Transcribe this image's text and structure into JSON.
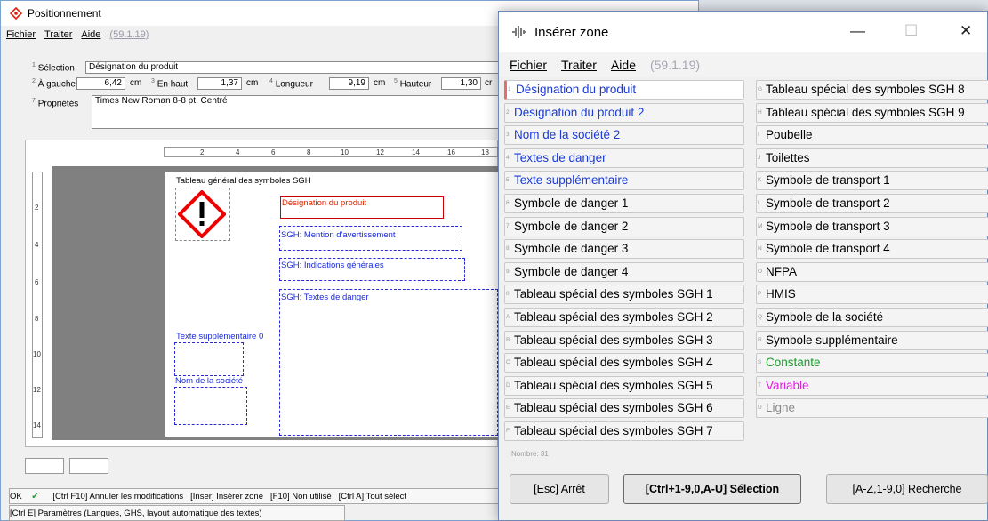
{
  "main": {
    "title": "Positionnement",
    "menu": {
      "fichier": "Fichier",
      "traiter": "Traiter",
      "aide": "Aide",
      "version": "(59.1.19)"
    },
    "fields": {
      "selection_label": "Sélection",
      "selection_value": "Désignation du produit",
      "left_label": "À gauche",
      "left_value": "6,42",
      "left_unit": "cm",
      "top_label": "En haut",
      "top_value": "1,37",
      "top_unit": "cm",
      "length_label": "Longueur",
      "length_value": "9,19",
      "length_unit": "cm",
      "height_label": "Hauteur",
      "height_value": "1,30",
      "height_unit": "cr",
      "props_label": "Propriétés",
      "props_value": "Times New Roman 8-8 pt, Centré"
    },
    "ruler_h": [
      "2",
      "4",
      "6",
      "8",
      "10",
      "12",
      "14",
      "16",
      "18"
    ],
    "ruler_v": [
      "2",
      "4",
      "6",
      "8",
      "10",
      "12",
      "14"
    ],
    "label": {
      "title": "Tableau général des symboles SGH",
      "product": "Désignation du produit",
      "warning": "SGH: Mention d'avertissement",
      "general": "SGH: Indications générales",
      "danger": "SGH: Textes de danger",
      "extra": "Texte supplémentaire 0",
      "company": "Nom de la société"
    },
    "bottom1": {
      "ok": "OK",
      "annuler": "[Ctrl F10] Annuler les modifications",
      "inserer": "[Inser] Insérer zone",
      "non": "[F10] Non utilisé",
      "tout": "[Ctrl A] Tout sélect"
    },
    "bottom2": "[Ctrl E] Paramètres (Langues, GHS, layout automatique des textes)"
  },
  "dialog": {
    "title": "Insérer zone",
    "menu": {
      "fichier": "Fichier",
      "traiter": "Traiter",
      "aide": "Aide",
      "version": "(59.1.19)"
    },
    "left": [
      {
        "k": "1",
        "t": "Désignation du produit",
        "c": "#1a3ad4"
      },
      {
        "k": "2",
        "t": "Désignation du produit 2",
        "c": "#1a3ad4"
      },
      {
        "k": "3",
        "t": "Nom de la société 2",
        "c": "#1a3ad4"
      },
      {
        "k": "4",
        "t": "Textes de danger",
        "c": "#1a3ad4"
      },
      {
        "k": "5",
        "t": "Texte supplémentaire",
        "c": "#1a3ad4"
      },
      {
        "k": "6",
        "t": "Symbole de danger 1",
        "c": "#000"
      },
      {
        "k": "7",
        "t": "Symbole de danger 2",
        "c": "#000"
      },
      {
        "k": "8",
        "t": "Symbole de danger 3",
        "c": "#000"
      },
      {
        "k": "9",
        "t": "Symbole de danger 4",
        "c": "#000"
      },
      {
        "k": "0",
        "t": "Tableau spécial des symboles SGH 1",
        "c": "#000"
      },
      {
        "k": "A",
        "t": "Tableau spécial des symboles SGH 2",
        "c": "#000"
      },
      {
        "k": "B",
        "t": "Tableau spécial des symboles SGH 3",
        "c": "#000"
      },
      {
        "k": "C",
        "t": "Tableau spécial des symboles SGH 4",
        "c": "#000"
      },
      {
        "k": "D",
        "t": "Tableau spécial des symboles SGH 5",
        "c": "#000"
      },
      {
        "k": "E",
        "t": "Tableau spécial des symboles SGH 6",
        "c": "#000"
      },
      {
        "k": "F",
        "t": "Tableau spécial des symboles SGH 7",
        "c": "#000"
      }
    ],
    "right": [
      {
        "k": "G",
        "t": "Tableau spécial des symboles SGH 8",
        "c": "#000"
      },
      {
        "k": "H",
        "t": "Tableau spécial des symboles SGH 9",
        "c": "#000"
      },
      {
        "k": "I",
        "t": "Poubelle",
        "c": "#000"
      },
      {
        "k": "J",
        "t": "Toilettes",
        "c": "#000"
      },
      {
        "k": "K",
        "t": "Symbole de transport 1",
        "c": "#000"
      },
      {
        "k": "L",
        "t": "Symbole de transport 2",
        "c": "#000"
      },
      {
        "k": "M",
        "t": "Symbole de transport 3",
        "c": "#000"
      },
      {
        "k": "N",
        "t": "Symbole de transport 4",
        "c": "#000"
      },
      {
        "k": "O",
        "t": "NFPA",
        "c": "#000"
      },
      {
        "k": "P",
        "t": "HMIS",
        "c": "#000"
      },
      {
        "k": "Q",
        "t": "Symbole de la société",
        "c": "#000"
      },
      {
        "k": "R",
        "t": "Symbole supplémentaire",
        "c": "#000"
      },
      {
        "k": "S",
        "t": "Constante",
        "c": "#1b9a2c"
      },
      {
        "k": "T",
        "t": "Variable",
        "c": "#e020e0"
      },
      {
        "k": "U",
        "t": "Ligne",
        "c": "#8a8a8a"
      }
    ],
    "count": "Nombre: 31",
    "btn_stop": "[Esc] Arrêt",
    "btn_select": "[Ctrl+1-9,0,A-U] Sélection",
    "btn_search": "[A-Z,1-9,0] Recherche"
  }
}
